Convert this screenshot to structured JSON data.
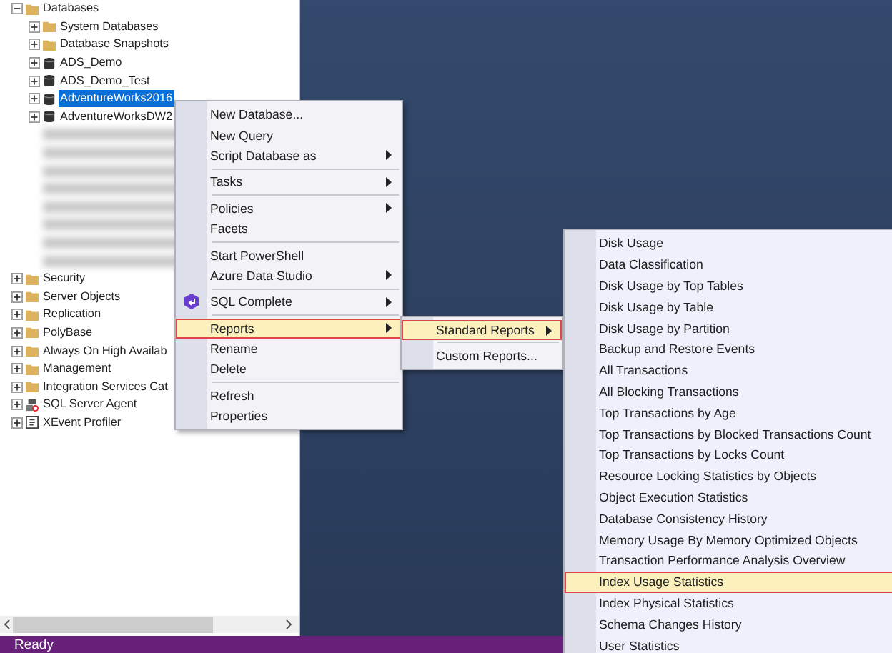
{
  "object_explorer": {
    "nodes": [
      {
        "kind": "folder",
        "label": "Databases",
        "expanded": true,
        "selected": false,
        "children": [
          {
            "kind": "folder",
            "label": "System Databases",
            "expanded": false,
            "selected": false
          },
          {
            "kind": "folder",
            "label": "Database Snapshots",
            "expanded": false,
            "selected": false
          },
          {
            "kind": "database",
            "label": "ADS_Demo",
            "expanded": false,
            "selected": false
          },
          {
            "kind": "database",
            "label": "ADS_Demo_Test",
            "expanded": false,
            "selected": false
          },
          {
            "kind": "database",
            "label": "AdventureWorks2016",
            "expanded": false,
            "selected": true
          },
          {
            "kind": "database",
            "label": "AdventureWorksDW2",
            "expanded": false,
            "selected": false
          },
          {
            "kind": "redacted"
          },
          {
            "kind": "redacted"
          },
          {
            "kind": "redacted"
          },
          {
            "kind": "redacted"
          },
          {
            "kind": "redacted"
          },
          {
            "kind": "redacted"
          },
          {
            "kind": "redacted"
          },
          {
            "kind": "redacted"
          }
        ]
      },
      {
        "kind": "folder",
        "label": "Security",
        "expanded": false,
        "selected": false
      },
      {
        "kind": "folder",
        "label": "Server Objects",
        "expanded": false,
        "selected": false
      },
      {
        "kind": "folder",
        "label": "Replication",
        "expanded": false,
        "selected": false
      },
      {
        "kind": "folder",
        "label": "PolyBase",
        "expanded": false,
        "selected": false
      },
      {
        "kind": "folder",
        "label": "Always On High Availab",
        "expanded": false,
        "selected": false
      },
      {
        "kind": "folder",
        "label": "Management",
        "expanded": false,
        "selected": false
      },
      {
        "kind": "folder",
        "label": "Integration Services Cat",
        "expanded": false,
        "selected": false
      },
      {
        "kind": "agent",
        "label": "SQL Server Agent",
        "expanded": false,
        "selected": false
      },
      {
        "kind": "xevent",
        "label": "XEvent Profiler",
        "expanded": false,
        "selected": false
      }
    ]
  },
  "context_menu": {
    "items": [
      {
        "kind": "item",
        "label": "New Database...",
        "submenu": false,
        "selected": false
      },
      {
        "kind": "item",
        "label": "New Query",
        "submenu": false,
        "selected": false
      },
      {
        "kind": "item",
        "label": "Script Database as",
        "submenu": true,
        "selected": false
      },
      {
        "kind": "separator"
      },
      {
        "kind": "item",
        "label": "Tasks",
        "submenu": true,
        "selected": false
      },
      {
        "kind": "separator"
      },
      {
        "kind": "item",
        "label": "Policies",
        "submenu": true,
        "selected": false
      },
      {
        "kind": "item",
        "label": "Facets",
        "submenu": false,
        "selected": false
      },
      {
        "kind": "separator"
      },
      {
        "kind": "item",
        "label": "Start PowerShell",
        "submenu": false,
        "selected": false
      },
      {
        "kind": "item",
        "label": "Azure Data Studio",
        "submenu": true,
        "selected": false
      },
      {
        "kind": "separator"
      },
      {
        "kind": "plugin",
        "label": "SQL Complete",
        "submenu": true,
        "selected": false
      },
      {
        "kind": "separator"
      },
      {
        "kind": "item",
        "label": "Reports",
        "submenu": true,
        "selected": true
      },
      {
        "kind": "item",
        "label": "Rename",
        "submenu": false,
        "selected": false
      },
      {
        "kind": "item",
        "label": "Delete",
        "submenu": false,
        "selected": false
      },
      {
        "kind": "separator"
      },
      {
        "kind": "item",
        "label": "Refresh",
        "submenu": false,
        "selected": false
      },
      {
        "kind": "item",
        "label": "Properties",
        "submenu": false,
        "selected": false
      }
    ]
  },
  "reports_menu": {
    "items": [
      {
        "kind": "item",
        "label": "Standard Reports",
        "submenu": true,
        "selected": true
      },
      {
        "kind": "separator"
      },
      {
        "kind": "item",
        "label": "Custom Reports...",
        "submenu": false,
        "selected": false
      }
    ]
  },
  "standard_reports_menu": {
    "items": [
      {
        "label": "Disk Usage",
        "selected": false
      },
      {
        "label": "Data Classification",
        "selected": false
      },
      {
        "label": "Disk Usage by Top Tables",
        "selected": false
      },
      {
        "label": "Disk Usage by Table",
        "selected": false
      },
      {
        "label": "Disk Usage by Partition",
        "selected": false
      },
      {
        "label": "Backup and Restore Events",
        "selected": false
      },
      {
        "label": "All Transactions",
        "selected": false
      },
      {
        "label": "All Blocking Transactions",
        "selected": false
      },
      {
        "label": "Top Transactions by Age",
        "selected": false
      },
      {
        "label": "Top Transactions by Blocked Transactions Count",
        "selected": false
      },
      {
        "label": "Top Transactions by Locks Count",
        "selected": false
      },
      {
        "label": "Resource Locking Statistics by Objects",
        "selected": false
      },
      {
        "label": "Object Execution Statistics",
        "selected": false
      },
      {
        "label": "Database Consistency History",
        "selected": false
      },
      {
        "label": "Memory Usage By Memory Optimized Objects",
        "selected": false
      },
      {
        "label": "Transaction Performance Analysis Overview",
        "selected": false
      },
      {
        "label": "Index Usage Statistics",
        "selected": true
      },
      {
        "label": "Index Physical Statistics",
        "selected": false
      },
      {
        "label": "Schema Changes History",
        "selected": false
      },
      {
        "label": "User Statistics",
        "selected": false
      }
    ]
  },
  "status_bar": {
    "text": "Ready"
  }
}
